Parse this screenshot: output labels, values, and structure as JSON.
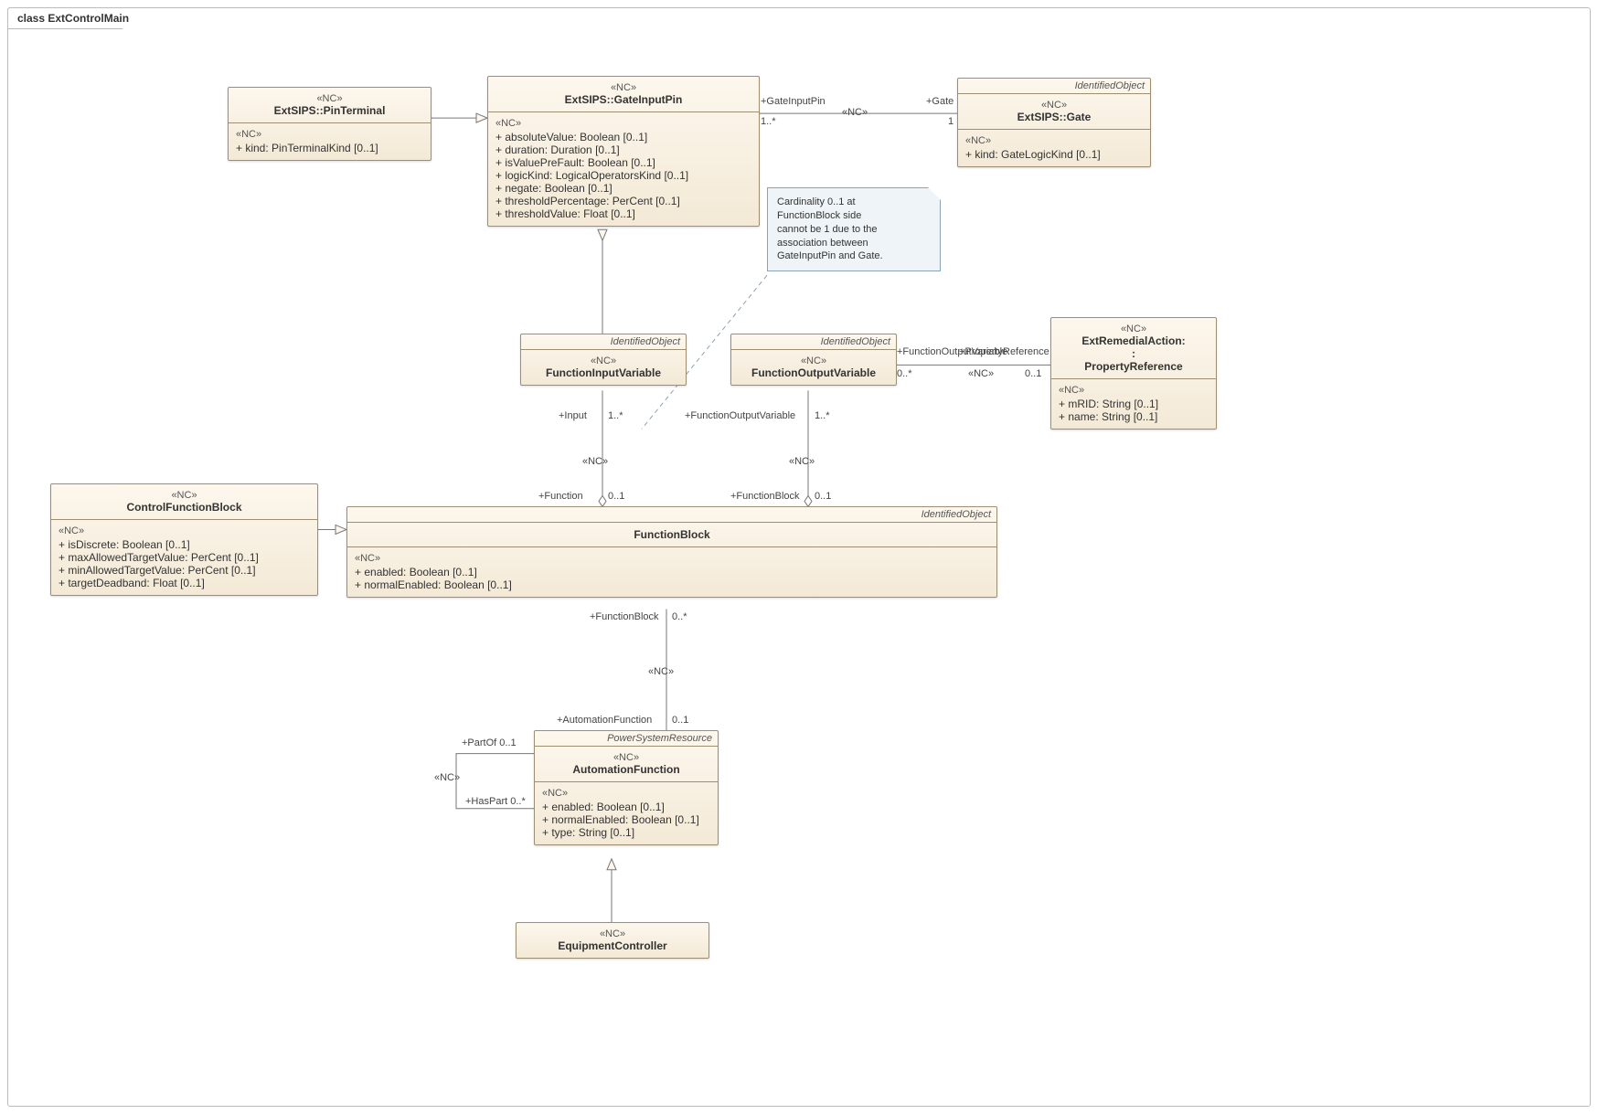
{
  "frame_title": "class ExtControlMain",
  "classes": {
    "pinTerminal": {
      "stereo": "«NC»",
      "name": "ExtSIPS::PinTerminal",
      "attr_stereo": "«NC»",
      "attrs": [
        "+   kind: PinTerminalKind [0..1]"
      ]
    },
    "gateInputPin": {
      "stereo": "«NC»",
      "name": "ExtSIPS::GateInputPin",
      "attr_stereo": "«NC»",
      "attrs": [
        "+   absoluteValue: Boolean [0..1]",
        "+   duration: Duration [0..1]",
        "+   isValuePreFault: Boolean [0..1]",
        "+   logicKind: LogicalOperatorsKind [0..1]",
        "+   negate: Boolean [0..1]",
        "+   thresholdPercentage: PerCent [0..1]",
        "+   thresholdValue: Float [0..1]"
      ]
    },
    "gate": {
      "parent": "IdentifiedObject",
      "stereo": "«NC»",
      "name": "ExtSIPS::Gate",
      "attr_stereo": "«NC»",
      "attrs": [
        "+   kind: GateLogicKind [0..1]"
      ]
    },
    "propertyRef": {
      "stereo": "«NC»",
      "name": "ExtRemedialAction:\n:\nPropertyReference",
      "attr_stereo": "«NC»",
      "attrs": [
        "+   mRID: String [0..1]",
        "+   name: String [0..1]"
      ]
    },
    "functionInputVar": {
      "parent": "IdentifiedObject",
      "stereo": "«NC»",
      "name": "FunctionInputVariable"
    },
    "functionOutputVar": {
      "parent": "IdentifiedObject",
      "stereo": "«NC»",
      "name": "FunctionOutputVariable"
    },
    "controlFB": {
      "stereo": "«NC»",
      "name": "ControlFunctionBlock",
      "attr_stereo": "«NC»",
      "attrs": [
        "+   isDiscrete: Boolean [0..1]",
        "+   maxAllowedTargetValue: PerCent [0..1]",
        "+   minAllowedTargetValue: PerCent [0..1]",
        "+   targetDeadband: Float [0..1]"
      ]
    },
    "functionBlock": {
      "parent": "IdentifiedObject",
      "name": "FunctionBlock",
      "attr_stereo": "«NC»",
      "attrs": [
        "+   enabled: Boolean [0..1]",
        "+   normalEnabled: Boolean [0..1]"
      ]
    },
    "automationFn": {
      "parent": "PowerSystemResource",
      "stereo": "«NC»",
      "name": "AutomationFunction",
      "attr_stereo": "«NC»",
      "attrs": [
        "+   enabled: Boolean [0..1]",
        "+   normalEnabled: Boolean [0..1]",
        "+   type: String [0..1]"
      ]
    },
    "equipCtrl": {
      "stereo": "«NC»",
      "name": "EquipmentController"
    }
  },
  "note": {
    "l1": "Cardinality 0..1 at",
    "l2": "FunctionBlock side",
    "l3": "cannot be 1 due to the",
    "l4": "association between",
    "l5": "GateInputPin and Gate."
  },
  "labels": {
    "gateInputPin_role": "+GateInputPin",
    "gateInputPin_mult": "1..*",
    "gate_role": "+Gate",
    "gate_mult": "1",
    "nc": "«NC»",
    "input_role": "+Input",
    "input_mult": "1..*",
    "fov_role": "+FunctionOutputVariable",
    "fov_mult": "1..*",
    "fov_mult2": "0..*",
    "propRef_role": "+PropertyReference",
    "propRef_mult": "0..1",
    "func_role": "+Function",
    "func_mult": "0..1",
    "fb_role": "+FunctionBlock",
    "fb_mult": "0..1",
    "fb_mult2": "0..*",
    "autoFn_role": "+AutomationFunction",
    "autoFn_mult": "0..1",
    "partOf": "+PartOf  0..1",
    "hasPart": "+HasPart 0..*"
  }
}
